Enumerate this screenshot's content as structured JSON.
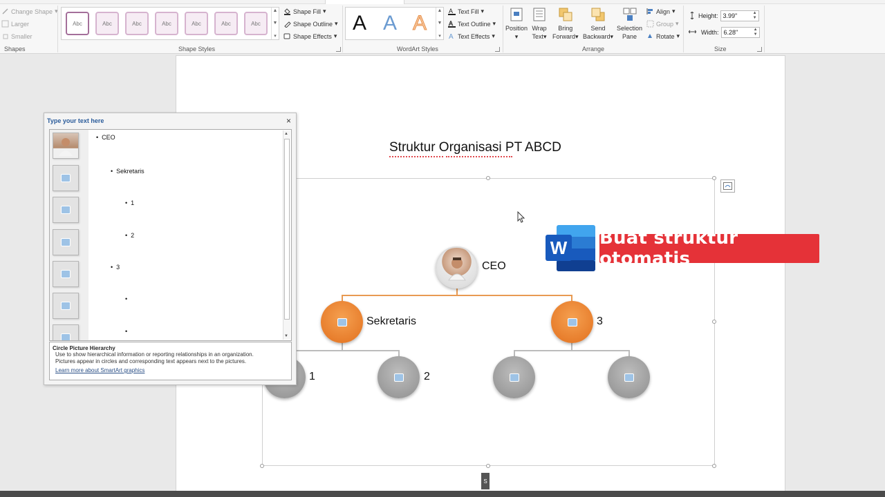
{
  "ribbon": {
    "shapes_group": {
      "change_shape": "Change Shape",
      "larger": "Larger",
      "smaller": "Smaller",
      "label": "Shapes"
    },
    "shape_styles": {
      "swatch_text": "Abc",
      "fill": "Shape Fill",
      "outline": "Shape Outline",
      "effects": "Shape Effects",
      "label": "Shape Styles"
    },
    "wordart_styles": {
      "letter": "A",
      "text_fill": "Text Fill",
      "text_outline": "Text Outline",
      "text_effects": "Text Effects",
      "label": "WordArt Styles"
    },
    "arrange": {
      "position": "Position",
      "wrap_text_1": "Wrap",
      "wrap_text_2": "Text",
      "bring_forward_1": "Bring",
      "bring_forward_2": "Forward",
      "send_backward_1": "Send",
      "send_backward_2": "Backward",
      "selection_pane_1": "Selection",
      "selection_pane_2": "Pane",
      "align": "Align",
      "group": "Group",
      "rotate": "Rotate",
      "label": "Arrange"
    },
    "size": {
      "height_label": "Height:",
      "height_value": "3.99\"",
      "width_label": "Width:",
      "width_value": "6.28\"",
      "label": "Size"
    }
  },
  "document": {
    "title": "Struktur Organisasi PT ABCD",
    "nodes": {
      "ceo": "CEO",
      "sekretaris": "Sekretaris",
      "three": "3",
      "one": "1",
      "two": "2"
    },
    "page_tag": "S"
  },
  "text_pane": {
    "title": "Type your text here",
    "close": "×",
    "items": [
      {
        "bullet": "•",
        "text": "CEO"
      },
      {
        "bullet": "•",
        "text": "Sekretaris"
      },
      {
        "bullet": "•",
        "text": "1"
      },
      {
        "bullet": "•",
        "text": "2"
      },
      {
        "bullet": "•",
        "text": "3"
      },
      {
        "bullet": "•",
        "text": ""
      },
      {
        "bullet": "•",
        "text": ""
      }
    ],
    "desc_title": "Circle Picture Hierarchy",
    "desc_body_1": "Use to show hierarchical information or reporting relationships in an organization.",
    "desc_body_2": "Pictures appear in circles and corresponding text appears next to the pictures.",
    "learn_more": "Learn more about SmartArt graphics"
  },
  "overlay": {
    "logo_letter": "W",
    "banner_text": "Buat struktur otomatis"
  },
  "colors": {
    "accent_orange": "#e2701e",
    "banner_red": "#e53238",
    "word_blue": "#2b579a"
  }
}
